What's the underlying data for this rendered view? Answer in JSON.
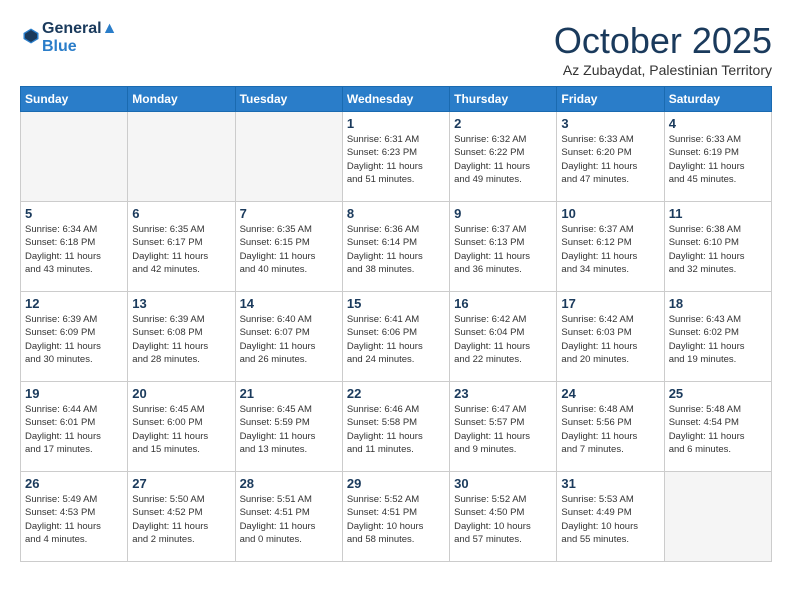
{
  "header": {
    "logo_line1": "General",
    "logo_line2": "Blue",
    "month": "October 2025",
    "location": "Az Zubaydat, Palestinian Territory"
  },
  "days_of_week": [
    "Sunday",
    "Monday",
    "Tuesday",
    "Wednesday",
    "Thursday",
    "Friday",
    "Saturday"
  ],
  "weeks": [
    [
      {
        "day": "",
        "info": ""
      },
      {
        "day": "",
        "info": ""
      },
      {
        "day": "",
        "info": ""
      },
      {
        "day": "1",
        "info": "Sunrise: 6:31 AM\nSunset: 6:23 PM\nDaylight: 11 hours\nand 51 minutes."
      },
      {
        "day": "2",
        "info": "Sunrise: 6:32 AM\nSunset: 6:22 PM\nDaylight: 11 hours\nand 49 minutes."
      },
      {
        "day": "3",
        "info": "Sunrise: 6:33 AM\nSunset: 6:20 PM\nDaylight: 11 hours\nand 47 minutes."
      },
      {
        "day": "4",
        "info": "Sunrise: 6:33 AM\nSunset: 6:19 PM\nDaylight: 11 hours\nand 45 minutes."
      }
    ],
    [
      {
        "day": "5",
        "info": "Sunrise: 6:34 AM\nSunset: 6:18 PM\nDaylight: 11 hours\nand 43 minutes."
      },
      {
        "day": "6",
        "info": "Sunrise: 6:35 AM\nSunset: 6:17 PM\nDaylight: 11 hours\nand 42 minutes."
      },
      {
        "day": "7",
        "info": "Sunrise: 6:35 AM\nSunset: 6:15 PM\nDaylight: 11 hours\nand 40 minutes."
      },
      {
        "day": "8",
        "info": "Sunrise: 6:36 AM\nSunset: 6:14 PM\nDaylight: 11 hours\nand 38 minutes."
      },
      {
        "day": "9",
        "info": "Sunrise: 6:37 AM\nSunset: 6:13 PM\nDaylight: 11 hours\nand 36 minutes."
      },
      {
        "day": "10",
        "info": "Sunrise: 6:37 AM\nSunset: 6:12 PM\nDaylight: 11 hours\nand 34 minutes."
      },
      {
        "day": "11",
        "info": "Sunrise: 6:38 AM\nSunset: 6:10 PM\nDaylight: 11 hours\nand 32 minutes."
      }
    ],
    [
      {
        "day": "12",
        "info": "Sunrise: 6:39 AM\nSunset: 6:09 PM\nDaylight: 11 hours\nand 30 minutes."
      },
      {
        "day": "13",
        "info": "Sunrise: 6:39 AM\nSunset: 6:08 PM\nDaylight: 11 hours\nand 28 minutes."
      },
      {
        "day": "14",
        "info": "Sunrise: 6:40 AM\nSunset: 6:07 PM\nDaylight: 11 hours\nand 26 minutes."
      },
      {
        "day": "15",
        "info": "Sunrise: 6:41 AM\nSunset: 6:06 PM\nDaylight: 11 hours\nand 24 minutes."
      },
      {
        "day": "16",
        "info": "Sunrise: 6:42 AM\nSunset: 6:04 PM\nDaylight: 11 hours\nand 22 minutes."
      },
      {
        "day": "17",
        "info": "Sunrise: 6:42 AM\nSunset: 6:03 PM\nDaylight: 11 hours\nand 20 minutes."
      },
      {
        "day": "18",
        "info": "Sunrise: 6:43 AM\nSunset: 6:02 PM\nDaylight: 11 hours\nand 19 minutes."
      }
    ],
    [
      {
        "day": "19",
        "info": "Sunrise: 6:44 AM\nSunset: 6:01 PM\nDaylight: 11 hours\nand 17 minutes."
      },
      {
        "day": "20",
        "info": "Sunrise: 6:45 AM\nSunset: 6:00 PM\nDaylight: 11 hours\nand 15 minutes."
      },
      {
        "day": "21",
        "info": "Sunrise: 6:45 AM\nSunset: 5:59 PM\nDaylight: 11 hours\nand 13 minutes."
      },
      {
        "day": "22",
        "info": "Sunrise: 6:46 AM\nSunset: 5:58 PM\nDaylight: 11 hours\nand 11 minutes."
      },
      {
        "day": "23",
        "info": "Sunrise: 6:47 AM\nSunset: 5:57 PM\nDaylight: 11 hours\nand 9 minutes."
      },
      {
        "day": "24",
        "info": "Sunrise: 6:48 AM\nSunset: 5:56 PM\nDaylight: 11 hours\nand 7 minutes."
      },
      {
        "day": "25",
        "info": "Sunrise: 5:48 AM\nSunset: 4:54 PM\nDaylight: 11 hours\nand 6 minutes."
      }
    ],
    [
      {
        "day": "26",
        "info": "Sunrise: 5:49 AM\nSunset: 4:53 PM\nDaylight: 11 hours\nand 4 minutes."
      },
      {
        "day": "27",
        "info": "Sunrise: 5:50 AM\nSunset: 4:52 PM\nDaylight: 11 hours\nand 2 minutes."
      },
      {
        "day": "28",
        "info": "Sunrise: 5:51 AM\nSunset: 4:51 PM\nDaylight: 11 hours\nand 0 minutes."
      },
      {
        "day": "29",
        "info": "Sunrise: 5:52 AM\nSunset: 4:51 PM\nDaylight: 10 hours\nand 58 minutes."
      },
      {
        "day": "30",
        "info": "Sunrise: 5:52 AM\nSunset: 4:50 PM\nDaylight: 10 hours\nand 57 minutes."
      },
      {
        "day": "31",
        "info": "Sunrise: 5:53 AM\nSunset: 4:49 PM\nDaylight: 10 hours\nand 55 minutes."
      },
      {
        "day": "",
        "info": ""
      }
    ]
  ]
}
